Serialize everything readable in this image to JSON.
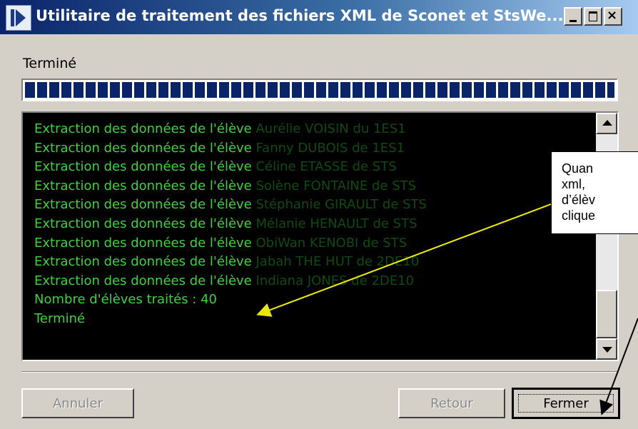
{
  "window": {
    "title": "Utilitaire de traitement des fichiers XML de Sconet et StsWe...",
    "controls": {
      "minimize_icon": "minimize-icon",
      "maximize_icon": "maximize-icon",
      "close_glyph": "×"
    }
  },
  "status": {
    "label": "Terminé",
    "progress": 1.0
  },
  "log": {
    "prefix": "Extraction des données de l'élève",
    "entries": [
      {
        "student": "Aurélie VOISIN du 1ES1"
      },
      {
        "student": "Fanny DUBOIS de 1ES1"
      },
      {
        "student": "Céline ETASSE de STS"
      },
      {
        "student": "Solène FONTAINE de STS"
      },
      {
        "student": "Stéphanie GIRAULT de STS"
      },
      {
        "student": "Mélanie HENAULT de STS"
      },
      {
        "student": "ObiWan KENOBI de STS"
      },
      {
        "student": "Jabah THE HUT de 2DE10"
      },
      {
        "student": "Indiana JONES de 2DE10"
      }
    ],
    "summary": "Nombre d'élèves traités : 40",
    "final": "Terminé",
    "colors": {
      "text": "#3cd23c",
      "faded": "#0d4a10",
      "background": "#000000"
    }
  },
  "buttons": {
    "cancel": "Annuler",
    "back": "Retour",
    "close": "Fermer"
  },
  "callout": {
    "lines": [
      "Quan",
      "xml,",
      "d’élèv",
      "clique"
    ]
  }
}
